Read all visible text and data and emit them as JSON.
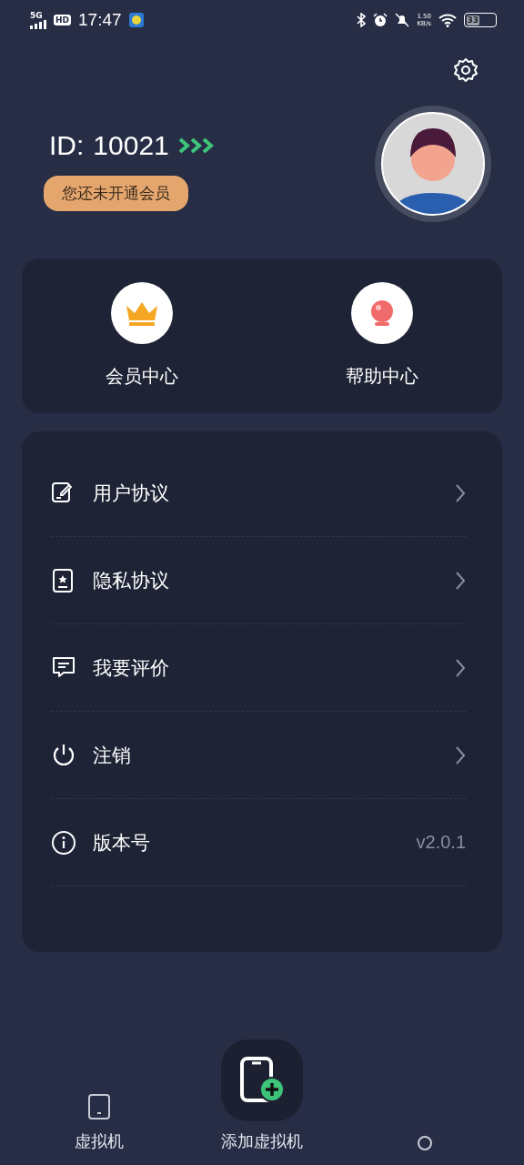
{
  "status_bar": {
    "network": "5G",
    "hd": "HD",
    "time": "17:47",
    "speed": "1.50",
    "speed_unit": "KB/s",
    "battery": "33"
  },
  "profile": {
    "id_label": "ID:",
    "id": "10021",
    "membership": "您还未开通会员"
  },
  "shortcuts": [
    {
      "kind": "crown",
      "label": "会员中心"
    },
    {
      "kind": "bulb",
      "label": "帮助中心"
    }
  ],
  "menu": [
    {
      "kind": "edit",
      "label": "用户协议"
    },
    {
      "kind": "star",
      "label": "隐私协议"
    },
    {
      "kind": "comment",
      "label": "我要评价"
    },
    {
      "kind": "power",
      "label": "注销"
    },
    {
      "kind": "info",
      "label": "版本号",
      "value": "v2.0.1"
    }
  ],
  "bottom_nav": [
    {
      "kind": "phone",
      "label": "虚拟机"
    },
    {
      "kind": "add",
      "label": "添加虚拟机"
    },
    {
      "kind": "hidden"
    }
  ]
}
